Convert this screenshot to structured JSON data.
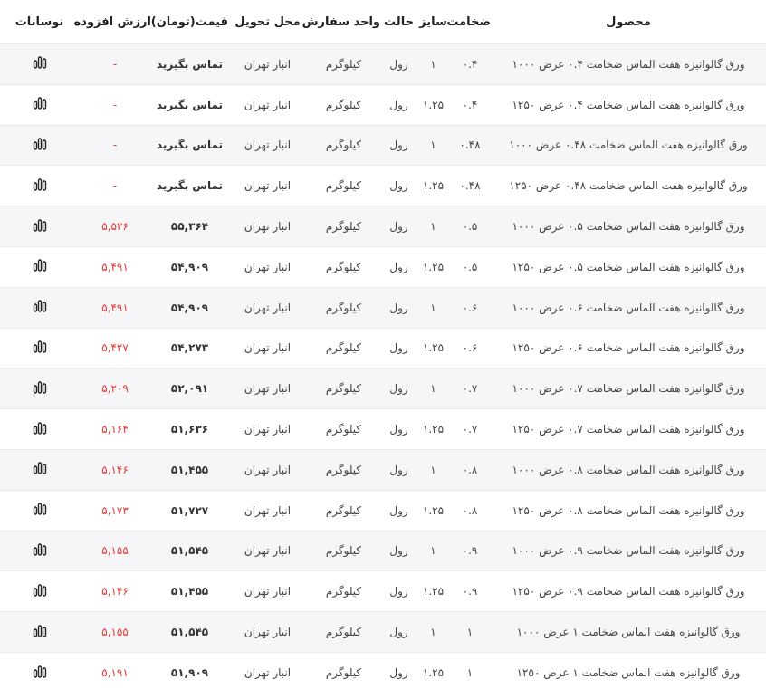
{
  "headers": {
    "product": "محصول",
    "thickness": "ضخامت",
    "size": "سایز",
    "state": "حالت",
    "unit": "واحد سفارش",
    "location": "محل تحویل",
    "price": "قیمت(تومان)",
    "added_value": "ارزش افزوده",
    "fluctuations": "نوسانات"
  },
  "rows": [
    {
      "product": "ورق گالوانیزه هفت الماس ضخامت ۰.۴ عرض ۱۰۰۰",
      "thickness": "۰.۴",
      "size": "۱",
      "state": "رول",
      "unit": "کیلوگرم",
      "location": "انبار تهران",
      "price": "تماس بگیرید",
      "added_value": "-"
    },
    {
      "product": "ورق گالوانیزه هفت الماس ضخامت ۰.۴ عرض ۱۲۵۰",
      "thickness": "۰.۴",
      "size": "۱.۲۵",
      "state": "رول",
      "unit": "کیلوگرم",
      "location": "انبار تهران",
      "price": "تماس بگیرید",
      "added_value": "-"
    },
    {
      "product": "ورق گالوانیزه هفت الماس ضخامت ۰.۴۸ عرض ۱۰۰۰",
      "thickness": "۰.۴۸",
      "size": "۱",
      "state": "رول",
      "unit": "کیلوگرم",
      "location": "انبار تهران",
      "price": "تماس بگیرید",
      "added_value": "-"
    },
    {
      "product": "ورق گالوانیزه هفت الماس ضخامت ۰.۴۸ عرض ۱۲۵۰",
      "thickness": "۰.۴۸",
      "size": "۱.۲۵",
      "state": "رول",
      "unit": "کیلوگرم",
      "location": "انبار تهران",
      "price": "تماس بگیرید",
      "added_value": "-"
    },
    {
      "product": "ورق گالوانیزه هفت الماس ضخامت ۰.۵ عرض ۱۰۰۰",
      "thickness": "۰.۵",
      "size": "۱",
      "state": "رول",
      "unit": "کیلوگرم",
      "location": "انبار تهران",
      "price": "۵۵,۳۶۴",
      "added_value": "۵,۵۳۶"
    },
    {
      "product": "ورق گالوانیزه هفت الماس ضخامت ۰.۵ عرض ۱۲۵۰",
      "thickness": "۰.۵",
      "size": "۱.۲۵",
      "state": "رول",
      "unit": "کیلوگرم",
      "location": "انبار تهران",
      "price": "۵۴,۹۰۹",
      "added_value": "۵,۴۹۱"
    },
    {
      "product": "ورق گالوانیزه هفت الماس ضخامت ۰.۶ عرض ۱۰۰۰",
      "thickness": "۰.۶",
      "size": "۱",
      "state": "رول",
      "unit": "کیلوگرم",
      "location": "انبار تهران",
      "price": "۵۴,۹۰۹",
      "added_value": "۵,۴۹۱"
    },
    {
      "product": "ورق گالوانیزه هفت الماس ضخامت ۰.۶ عرض ۱۲۵۰",
      "thickness": "۰.۶",
      "size": "۱.۲۵",
      "state": "رول",
      "unit": "کیلوگرم",
      "location": "انبار تهران",
      "price": "۵۴,۲۷۳",
      "added_value": "۵,۴۲۷"
    },
    {
      "product": "ورق گالوانیزه هفت الماس ضخامت ۰.۷ عرض ۱۰۰۰",
      "thickness": "۰.۷",
      "size": "۱",
      "state": "رول",
      "unit": "کیلوگرم",
      "location": "انبار تهران",
      "price": "۵۲,۰۹۱",
      "added_value": "۵,۲۰۹"
    },
    {
      "product": "ورق گالوانیزه هفت الماس ضخامت ۰.۷ عرض ۱۲۵۰",
      "thickness": "۰.۷",
      "size": "۱.۲۵",
      "state": "رول",
      "unit": "کیلوگرم",
      "location": "انبار تهران",
      "price": "۵۱,۶۳۶",
      "added_value": "۵,۱۶۴"
    },
    {
      "product": "ورق گالوانیزه هفت الماس ضخامت ۰.۸ عرض ۱۰۰۰",
      "thickness": "۰.۸",
      "size": "۱",
      "state": "رول",
      "unit": "کیلوگرم",
      "location": "انبار تهران",
      "price": "۵۱,۴۵۵",
      "added_value": "۵,۱۴۶"
    },
    {
      "product": "ورق گالوانیزه هفت الماس ضخامت ۰.۸ عرض ۱۲۵۰",
      "thickness": "۰.۸",
      "size": "۱.۲۵",
      "state": "رول",
      "unit": "کیلوگرم",
      "location": "انبار تهران",
      "price": "۵۱,۷۲۷",
      "added_value": "۵,۱۷۳"
    },
    {
      "product": "ورق گالوانیزه هفت الماس ضخامت ۰.۹ عرض ۱۰۰۰",
      "thickness": "۰.۹",
      "size": "۱",
      "state": "رول",
      "unit": "کیلوگرم",
      "location": "انبار تهران",
      "price": "۵۱,۵۴۵",
      "added_value": "۵,۱۵۵"
    },
    {
      "product": "ورق گالوانیزه هفت الماس ضخامت ۰.۹ عرض ۱۲۵۰",
      "thickness": "۰.۹",
      "size": "۱.۲۵",
      "state": "رول",
      "unit": "کیلوگرم",
      "location": "انبار تهران",
      "price": "۵۱,۴۵۵",
      "added_value": "۵,۱۴۶"
    },
    {
      "product": "ورق گالوانیزه هفت الماس ضخامت ۱ عرض ۱۰۰۰",
      "thickness": "۱",
      "size": "۱",
      "state": "رول",
      "unit": "کیلوگرم",
      "location": "انبار تهران",
      "price": "۵۱,۵۴۵",
      "added_value": "۵,۱۵۵"
    },
    {
      "product": "ورق گالوانیزه هفت الماس ضخامت ۱ عرض ۱۲۵۰",
      "thickness": "۱",
      "size": "۱.۲۵",
      "state": "رول",
      "unit": "کیلوگرم",
      "location": "انبار تهران",
      "price": "۵۱,۹۰۹",
      "added_value": "۵,۱۹۱"
    }
  ],
  "icons": {
    "fluctuation": "bar-chart-icon"
  },
  "colors": {
    "added_value": "#e53935",
    "stripe": "#f6f6f8"
  }
}
